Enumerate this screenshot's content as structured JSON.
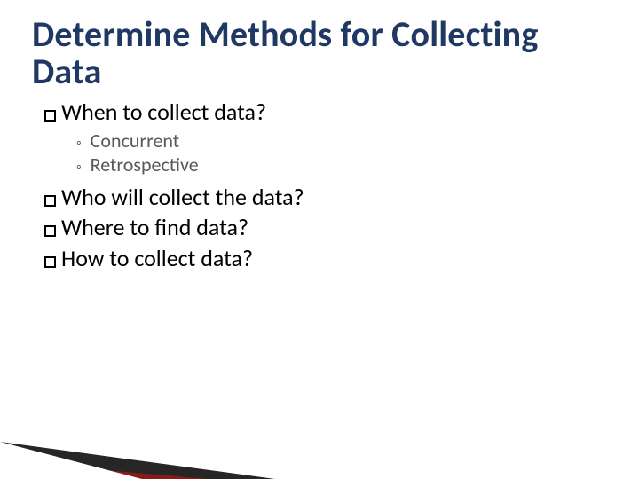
{
  "title": "Determine Methods for Collecting Data",
  "bullets": [
    {
      "text": "When to collect data?"
    },
    {
      "text": "Who will collect the data?"
    },
    {
      "text": "Where to find data?"
    },
    {
      "text": "How to collect data?"
    }
  ],
  "sub_bullets_after_first": [
    {
      "text": "Concurrent"
    },
    {
      "text": "Retrospective"
    }
  ],
  "colors": {
    "title": "#1f3864",
    "subtext": "#595959",
    "wedge_dark": "#262626",
    "wedge_accent": "#8a1a16"
  }
}
